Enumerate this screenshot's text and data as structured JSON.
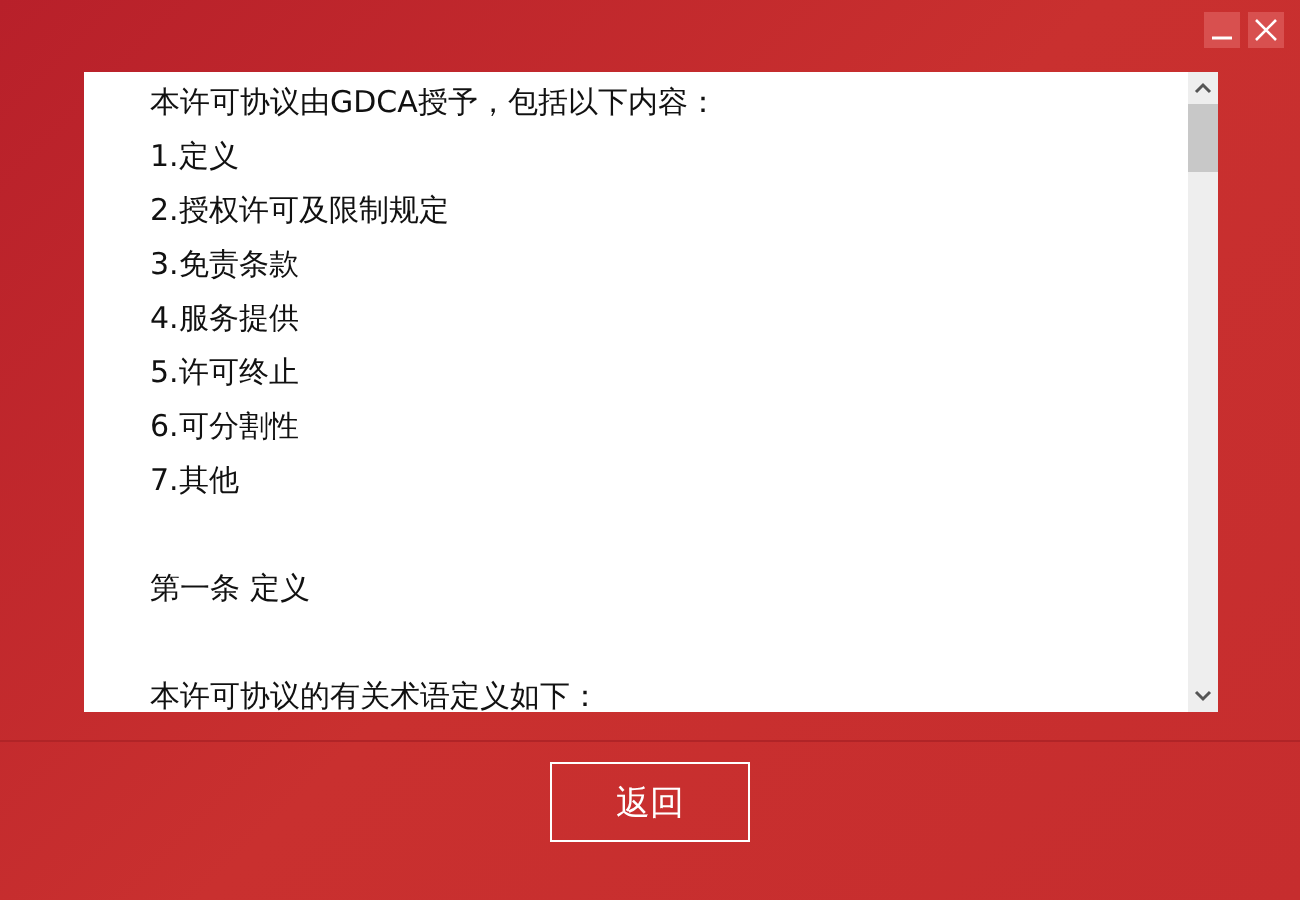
{
  "agreement": {
    "paragraphs": [
      {
        "lines": [
          "本许可协议由GDCA授予，包括以下内容：",
          "1.定义",
          "2.授权许可及限制规定",
          "3.免责条款",
          "4.服务提供",
          "5.许可终止",
          "6.可分割性",
          "7.其他"
        ]
      },
      {
        "lines": [
          "第一条 定义"
        ]
      },
      {
        "lines": [
          "本许可协议的有关术语定义如下："
        ]
      }
    ]
  },
  "buttons": [
    {
      "label": "返回"
    }
  ]
}
